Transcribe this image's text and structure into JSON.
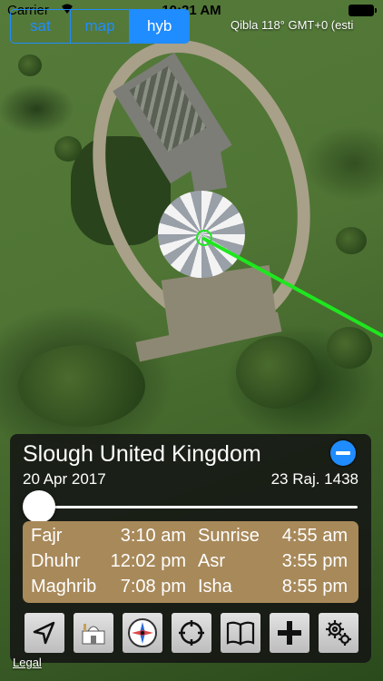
{
  "status_bar": {
    "carrier": "Carrier",
    "time": "10:21 AM"
  },
  "map_type": {
    "options": [
      "sat",
      "map",
      "hyb"
    ],
    "selected": "hyb"
  },
  "qibla_info": "Qibla 118° GMT+0 (esti",
  "location": {
    "city": "Slough United Kingdom",
    "gregorian_date": "20 Apr 2017",
    "hijri_date": "23 Raj. 1438"
  },
  "prayer_times": [
    {
      "name": "Fajr",
      "time": "3:10 am"
    },
    {
      "name": "Sunrise",
      "time": "4:55 am"
    },
    {
      "name": "Dhuhr",
      "time": "12:02 pm"
    },
    {
      "name": "Asr",
      "time": "3:55 pm"
    },
    {
      "name": "Maghrib",
      "time": "7:08 pm"
    },
    {
      "name": "Isha",
      "time": "8:55 pm"
    }
  ],
  "time_slider": {
    "value": 0
  },
  "toolbar": [
    "location-arrow-icon",
    "mosque-icon",
    "compass-icon",
    "crosshair-icon",
    "book-icon",
    "plus-icon",
    "gear-icon"
  ],
  "legal_link": "Legal",
  "colors": {
    "accent": "#1f8cff",
    "qibla_line": "#1fe61f",
    "times_panel": "#a8895a"
  }
}
